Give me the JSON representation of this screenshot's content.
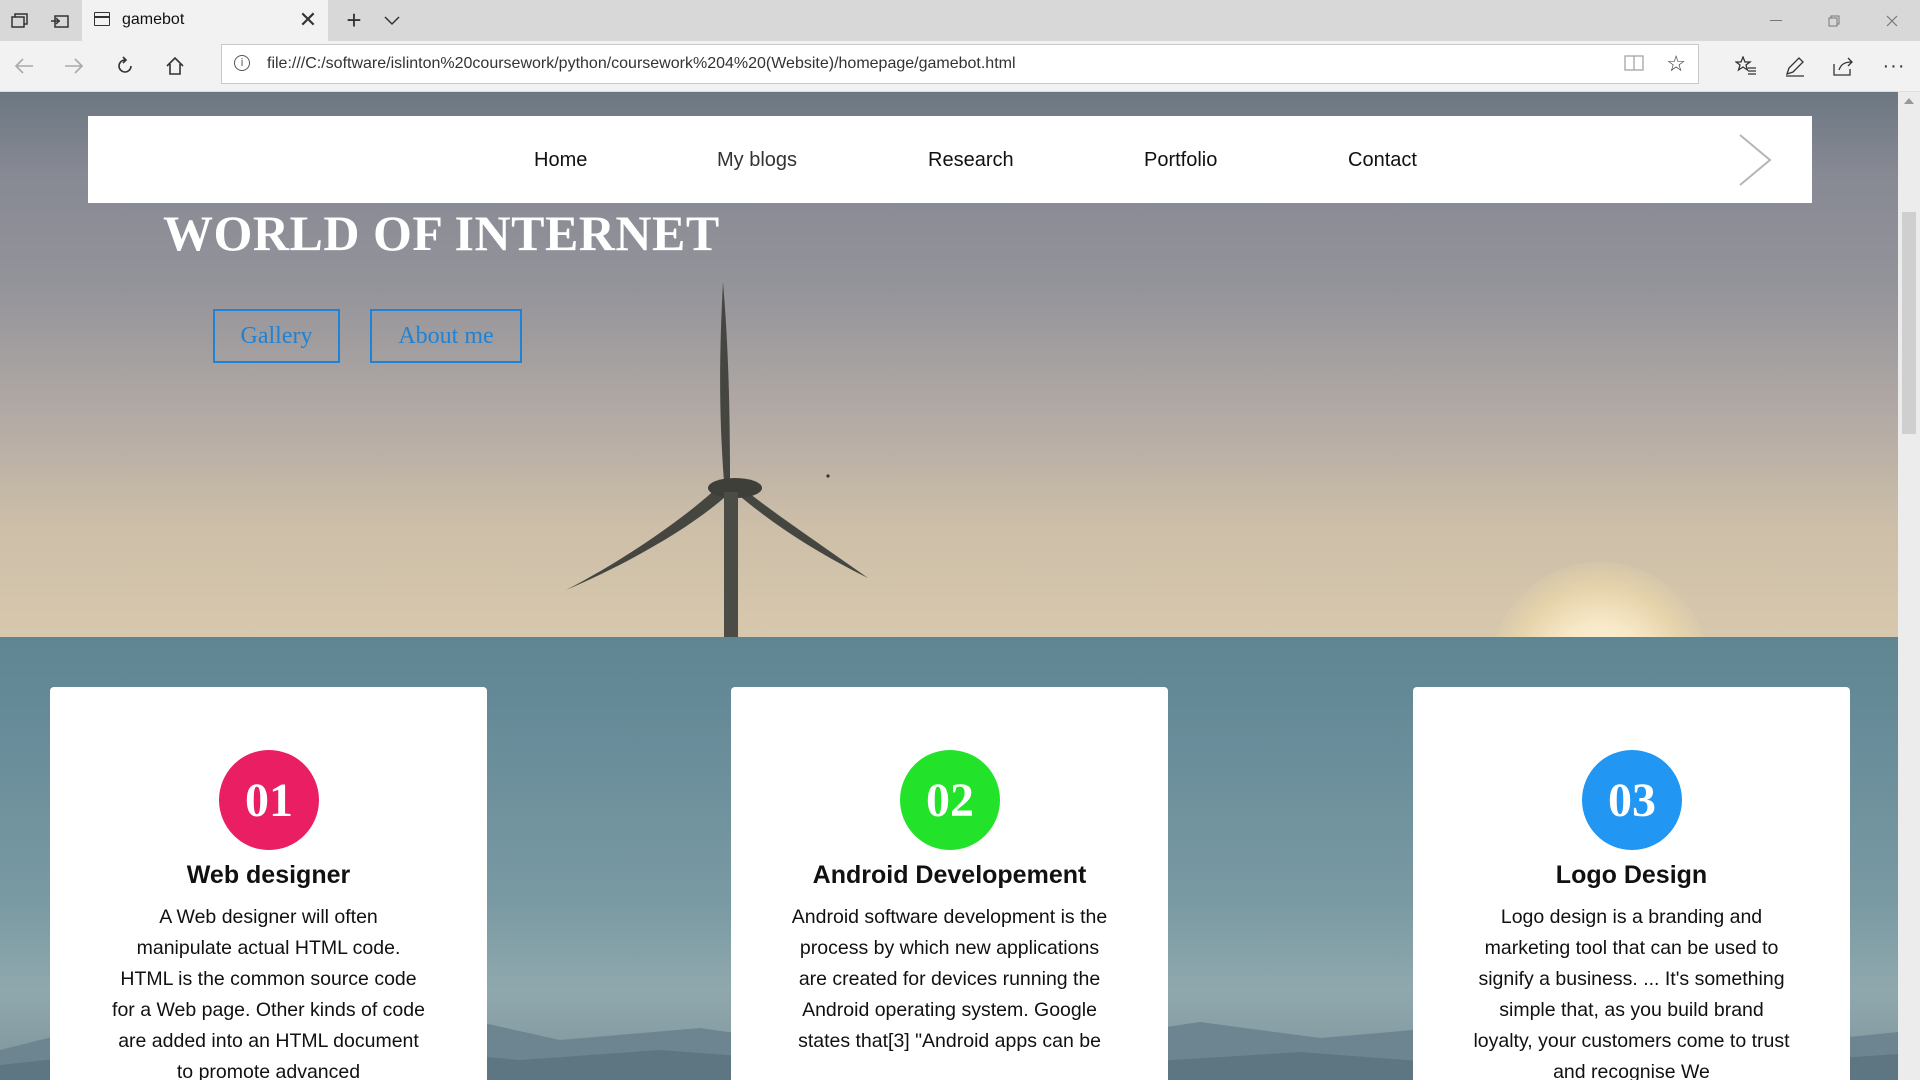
{
  "browser": {
    "tab_title": "gamebot",
    "url": "file:///C:/software/islinton%20coursework/python/coursework%204%20(Website)/homepage/gamebot.html"
  },
  "nav": {
    "links": [
      "Home",
      "My blogs",
      "Research",
      "Portfolio",
      "Contact"
    ]
  },
  "hero": {
    "title": "WORLD OF INTERNET",
    "buttons": [
      "Gallery",
      "About me"
    ]
  },
  "cards": [
    {
      "number": "01",
      "title": "Web designer",
      "body": "A Web designer will often manipulate actual HTML code. HTML is the common source code for a Web page. Other kinds of code are added into an HTML document to promote advanced",
      "color": "#e91e63"
    },
    {
      "number": "02",
      "title": "Android Developement",
      "body": "Android software development is the process by which new applications are created for devices running the Android operating system. Google states that[3] \"Android apps can be",
      "color": "#22e32a"
    },
    {
      "number": "03",
      "title": "Logo Design",
      "body": "Logo design is a branding and marketing tool that can be used to signify a business. ... It's something simple that, as you build brand loyalty, your customers come to trust and recognise We",
      "color": "#2196f3"
    }
  ]
}
